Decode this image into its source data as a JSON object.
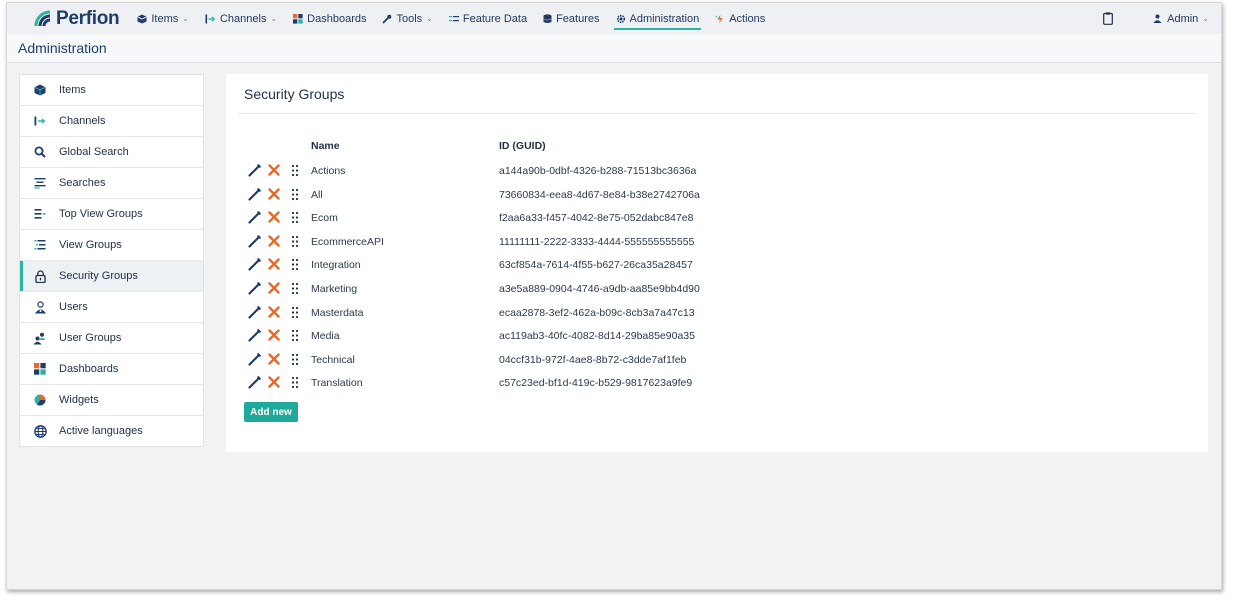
{
  "app": {
    "brand": "Perfion",
    "accent_color": "#2bb3a3",
    "brand_color": "#1f3d6b"
  },
  "topnav": {
    "items": [
      {
        "label": "Items",
        "icon": "cube-icon",
        "dropdown": true
      },
      {
        "label": "Channels",
        "icon": "channel-arrow-icon",
        "dropdown": true
      },
      {
        "label": "Dashboards",
        "icon": "dashboard-grid-icon",
        "dropdown": false
      },
      {
        "label": "Tools",
        "icon": "wrench-icon",
        "dropdown": true
      },
      {
        "label": "Feature Data",
        "icon": "list-lines-icon",
        "dropdown": false
      },
      {
        "label": "Features",
        "icon": "database-icon",
        "dropdown": false
      },
      {
        "label": "Administration",
        "icon": "gear-icon",
        "dropdown": false,
        "active": true
      },
      {
        "label": "Actions",
        "icon": "lightning-icon",
        "dropdown": false
      }
    ],
    "user": {
      "label": "Admin",
      "icon": "user-icon"
    },
    "clipboard_icon": "clipboard-icon"
  },
  "page": {
    "title": "Administration"
  },
  "sidebar": {
    "items": [
      {
        "label": "Items",
        "icon": "cube-icon"
      },
      {
        "label": "Channels",
        "icon": "channel-arrow-icon"
      },
      {
        "label": "Global Search",
        "icon": "search-icon"
      },
      {
        "label": "Searches",
        "icon": "searches-list-icon"
      },
      {
        "label": "Top View Groups",
        "icon": "top-view-groups-icon"
      },
      {
        "label": "View Groups",
        "icon": "view-groups-icon"
      },
      {
        "label": "Security Groups",
        "icon": "lock-icon",
        "active": true
      },
      {
        "label": "Users",
        "icon": "users-icon"
      },
      {
        "label": "User Groups",
        "icon": "user-groups-icon"
      },
      {
        "label": "Dashboards",
        "icon": "dashboard-grid-icon"
      },
      {
        "label": "Widgets",
        "icon": "pie-chart-icon"
      },
      {
        "label": "Active languages",
        "icon": "globe-icon"
      }
    ]
  },
  "main": {
    "title": "Security Groups",
    "columns": {
      "name": "Name",
      "guid": "ID (GUID)"
    },
    "rows": [
      {
        "name": "Actions",
        "guid": "a144a90b-0dbf-4326-b288-71513bc3636a"
      },
      {
        "name": "All",
        "guid": "73660834-eea8-4d67-8e84-b38e2742706a"
      },
      {
        "name": "Ecom",
        "guid": "f2aa6a33-f457-4042-8e75-052dabc847e8"
      },
      {
        "name": "EcommerceAPI",
        "guid": "11111111-2222-3333-4444-555555555555"
      },
      {
        "name": "Integration",
        "guid": "63cf854a-7614-4f55-b627-26ca35a28457"
      },
      {
        "name": "Marketing",
        "guid": "a3e5a889-0904-4746-a9db-aa85e9bb4d90"
      },
      {
        "name": "Masterdata",
        "guid": "ecaa2878-3ef2-462a-b09c-8cb3a7a47c13"
      },
      {
        "name": "Media",
        "guid": "ac119ab3-40fc-4082-8d14-29ba85e90a35"
      },
      {
        "name": "Technical",
        "guid": "04ccf31b-972f-4ae8-8b72-c3dde7af1feb"
      },
      {
        "name": "Translation",
        "guid": "c57c23ed-bf1d-419c-b529-9817623a9fe9"
      }
    ],
    "row_actions": [
      "pencil-edit-icon",
      "delete-x-icon",
      "drag-handle-icon"
    ],
    "add_button": "Add new",
    "add_button_color": "#1fa99a",
    "edit_color": "#1f3d6b",
    "delete_color": "#e8692a"
  }
}
